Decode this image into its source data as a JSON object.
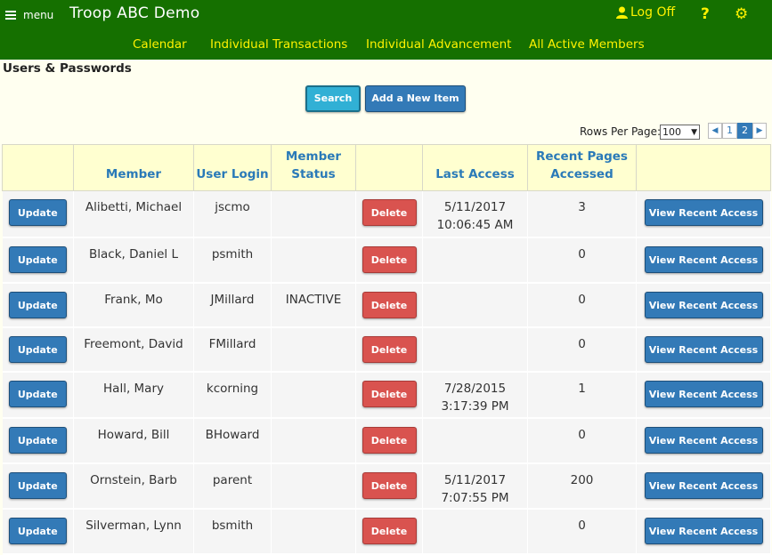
{
  "header": {
    "menu_label": "menu",
    "app_title": "Troop ABC Demo",
    "logoff_label": "Log Off",
    "help_label": "?",
    "nav": [
      "Calendar",
      "Individual Transactions",
      "Individual Advancement",
      "All Active Members"
    ]
  },
  "page": {
    "title": "Users & Passwords",
    "search_label": "Search",
    "add_label": "Add a New Item",
    "rows_per_page_label": "Rows Per Page:",
    "rows_per_page_value": "100",
    "pages": [
      "1",
      "2"
    ],
    "active_page": "2"
  },
  "table": {
    "headers": [
      "",
      "Member",
      "User Login",
      "Member Status",
      "",
      "Last Access",
      "Recent Pages Accessed",
      ""
    ],
    "update_label": "Update",
    "delete_label": "Delete",
    "recent_label": "View Recent Access",
    "rows": [
      {
        "member": "Alibetti, Michael",
        "login": "jscmo",
        "status": "",
        "last_date": "5/11/2017",
        "last_time": "10:06:45 AM",
        "recent": "3"
      },
      {
        "member": "Black, Daniel L",
        "login": "psmith",
        "status": "",
        "last_date": "",
        "last_time": "",
        "recent": "0"
      },
      {
        "member": "Frank, Mo",
        "login": "JMillard",
        "status": "INACTIVE",
        "last_date": "",
        "last_time": "",
        "recent": "0"
      },
      {
        "member": "Freemont, David",
        "login": "FMillard",
        "status": "",
        "last_date": "",
        "last_time": "",
        "recent": "0"
      },
      {
        "member": "Hall, Mary",
        "login": "kcorning",
        "status": "",
        "last_date": "7/28/2015",
        "last_time": "3:17:39 PM",
        "recent": "1"
      },
      {
        "member": "Howard, Bill",
        "login": "BHoward",
        "status": "",
        "last_date": "",
        "last_time": "",
        "recent": "0"
      },
      {
        "member": "Ornstein, Barb",
        "login": "parent",
        "status": "",
        "last_date": "5/11/2017",
        "last_time": "7:07:55 PM",
        "recent": "200"
      },
      {
        "member": "Silverman, Lynn",
        "login": "bsmith",
        "status": "",
        "last_date": "",
        "last_time": "",
        "recent": "0"
      }
    ]
  },
  "colors": {
    "header_bg": "#157000",
    "nav_link": "#fff200",
    "primary": "#337ab7",
    "danger": "#d9534f",
    "info": "#31b0d5",
    "table_header_bg": "#ffffd0"
  }
}
